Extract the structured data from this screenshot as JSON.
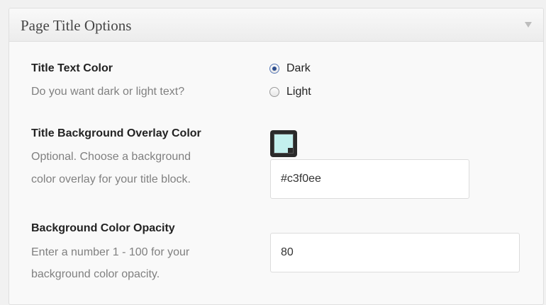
{
  "panel": {
    "title": "Page Title Options",
    "toggle_icon": "triangle-down-icon"
  },
  "title_text_color": {
    "label": "Title Text Color",
    "description": "Do you want dark or light text?",
    "options": [
      {
        "label": "Dark",
        "checked": true
      },
      {
        "label": "Light",
        "checked": false
      }
    ]
  },
  "overlay_color": {
    "label": "Title Background Overlay Color",
    "description_line1": "Optional. Choose a background",
    "description_line2": "color overlay for your title block.",
    "swatch_color": "#c3f0ee",
    "value": "#c3f0ee"
  },
  "opacity": {
    "label": "Background Color Opacity",
    "description_line1": "Enter a number 1 - 100 for your",
    "description_line2": "background color opacity.",
    "value": "80"
  }
}
